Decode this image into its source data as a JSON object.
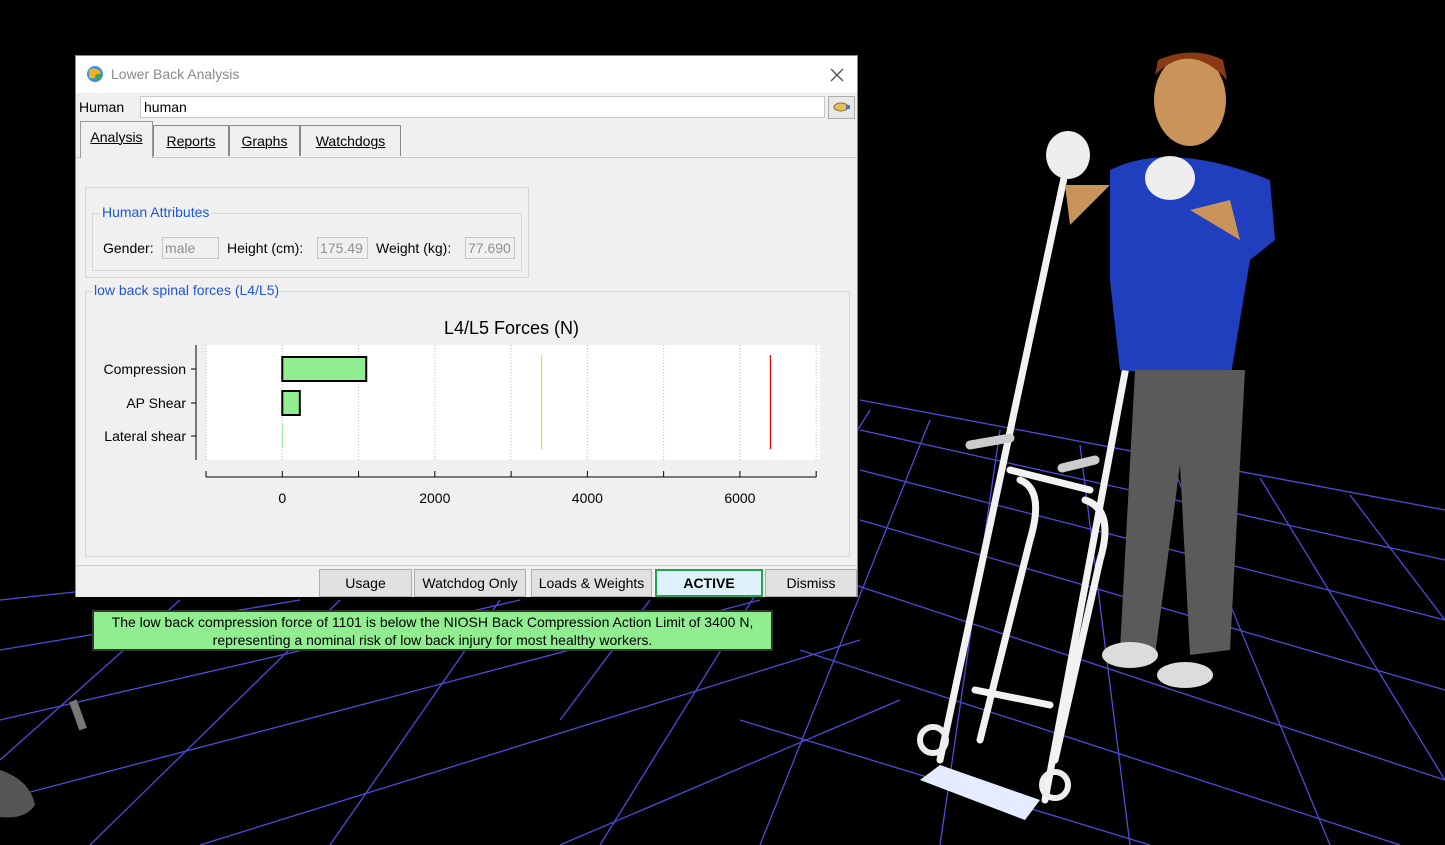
{
  "window": {
    "title": "Lower Back Analysis"
  },
  "human": {
    "label": "Human",
    "value": "human"
  },
  "tabs": [
    {
      "label": "Analysis",
      "selected": true
    },
    {
      "label": "Reports",
      "selected": false
    },
    {
      "label": "Graphs",
      "selected": false
    },
    {
      "label": "Watchdogs",
      "selected": false
    }
  ],
  "attributes": {
    "group_label": "Human Attributes",
    "gender_label": "Gender:",
    "gender_value": "male",
    "height_label": "Height  (cm):",
    "height_value": "175.49",
    "weight_label": "Weight  (kg):",
    "weight_value": "77.690"
  },
  "forces": {
    "group_label": "low back spinal forces (L4/L5)"
  },
  "chart_data": {
    "type": "bar",
    "orientation": "horizontal",
    "title": "L4/L5 Forces (N)",
    "categories": [
      "Compression",
      "AP Shear",
      "Lateral shear"
    ],
    "values": [
      1101,
      230,
      0
    ],
    "xlim": [
      -1000,
      7050
    ],
    "xticks": [
      0,
      2000,
      4000,
      6000
    ],
    "grid": true,
    "bar_color": "#90ee90",
    "limits": [
      {
        "value": 3400,
        "color": "#e6e600"
      },
      {
        "value": 6400,
        "color": "#e60000"
      }
    ]
  },
  "message": {
    "line1": "The low back compression force of 1101 is below the NIOSH Back Compression Action Limit of 3400 N,",
    "line2": "representing a nominal risk of low back injury for most healthy workers."
  },
  "buttons": {
    "usage": "Usage",
    "watchdog_only": "Watchdog Only",
    "loads_weights": "Loads & Weights",
    "active": "ACTIVE",
    "dismiss": "Dismiss"
  },
  "colors": {
    "accent": "#1f55d6",
    "ok": "#90ee90",
    "active_border": "#21a64c",
    "grid_lines": "#5555ff"
  }
}
